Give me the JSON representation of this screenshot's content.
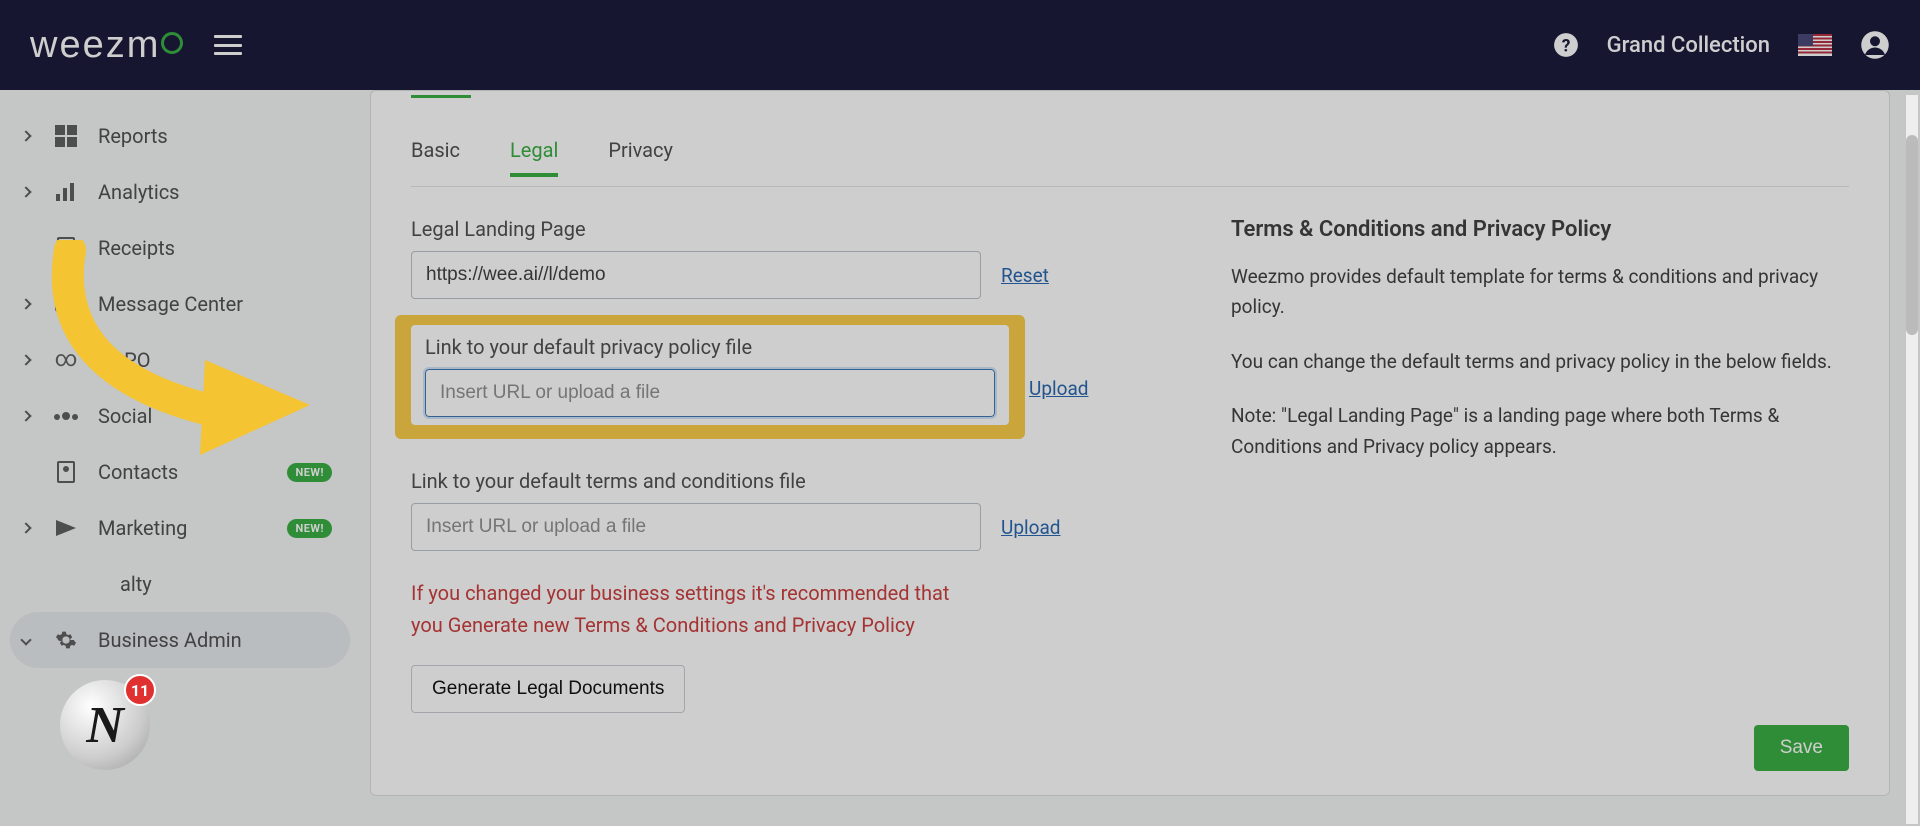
{
  "topbar": {
    "logo_text": "weezm",
    "collection": "Grand Collection"
  },
  "sidebar": {
    "items": [
      {
        "label": "Reports",
        "icon": "dashboard-icon"
      },
      {
        "label": "Analytics",
        "icon": "analytics-icon"
      },
      {
        "label": "Receipts",
        "icon": "receipts-icon"
      },
      {
        "label": "Message Center",
        "icon": "message-icon"
      },
      {
        "label": "ROPO",
        "icon": "ropo-icon"
      },
      {
        "label": "Social",
        "icon": "social-icon"
      },
      {
        "label": "Contacts",
        "icon": "contacts-icon",
        "badge": "NEW!"
      },
      {
        "label": "Marketing",
        "icon": "marketing-icon",
        "badge": "NEW!"
      },
      {
        "label": "Loyalty",
        "icon": "loyalty-icon"
      },
      {
        "label": "Business Admin",
        "icon": "settings-icon",
        "active": true
      }
    ]
  },
  "subtabs": {
    "basic": "Basic",
    "legal": "Legal",
    "privacy": "Privacy"
  },
  "form": {
    "landing_label": "Legal Landing Page",
    "landing_value": "https://wee.ai//l/demo",
    "reset": "Reset",
    "privacy_label": "Link to your default privacy policy file",
    "privacy_value": "",
    "placeholder": "Insert URL or upload a file",
    "terms_label": "Link to your default terms and conditions file",
    "terms_value": "",
    "upload": "Upload",
    "warning": "If you changed your business settings it's recommended that you Generate new Terms & Conditions and Privacy Policy",
    "generate_btn": "Generate Legal Documents",
    "save_btn": "Save"
  },
  "info": {
    "title": "Terms & Conditions and Privacy Policy",
    "p1": "Weezmo provides default template for terms & conditions and privacy policy.",
    "p2": "You can change the default terms and privacy policy in the below fields.",
    "p3": "Note: \"Legal Landing Page\" is a landing page where both Terms & Conditions and Privacy policy appears."
  },
  "bubble": {
    "letter": "N",
    "count": "11"
  },
  "loyalty_fragment": "alty"
}
